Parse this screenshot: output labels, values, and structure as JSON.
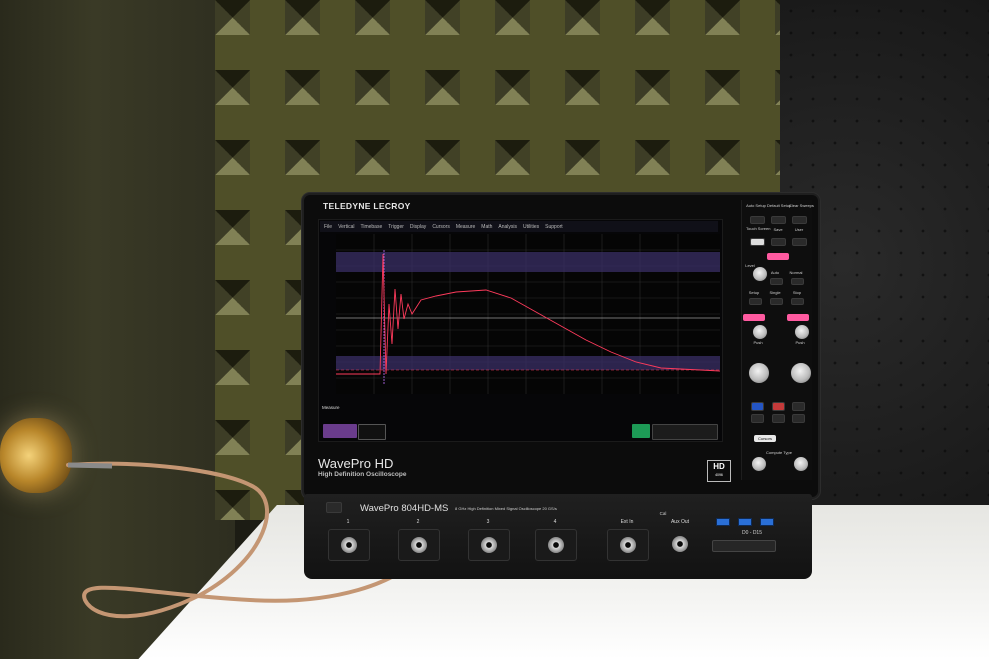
{
  "brand": {
    "name": "TELEDYNE LECROY"
  },
  "model": {
    "title": "WavePro HD",
    "subtitle": "High Definition Oscilloscope",
    "front_label": "WavePro 804HD-MS",
    "front_spec": "8 GHz High Definition Mixed Signal Oscilloscope   20 GS/s",
    "badge_main": "HD",
    "badge_sub": "4096"
  },
  "screen": {
    "menu": [
      "File",
      "Vertical",
      "Timebase",
      "Trigger",
      "Display",
      "Cursors",
      "Measure",
      "Math",
      "Analysis",
      "Utilities",
      "Support"
    ],
    "measure_label": "Measure"
  },
  "controls": {
    "auto_setup": "Auto Setup",
    "default_setup": "Default Setup",
    "clear_sweeps": "Clear Sweeps",
    "touch_screen": "Touch Screen",
    "save": "Save",
    "user": "User",
    "level": "Level",
    "auto": "Auto",
    "normal": "Normal",
    "setup": "Setup",
    "single": "Single",
    "stop": "Stop",
    "push": "Push",
    "cursors": "Cursors",
    "compute_type": "Compute Type"
  },
  "front": {
    "channels": [
      "1",
      "2",
      "3",
      "4"
    ],
    "ext_in": "Ext In",
    "aux_out": "Aux Out",
    "cal": "Cal",
    "digital": "D0 - D15"
  }
}
